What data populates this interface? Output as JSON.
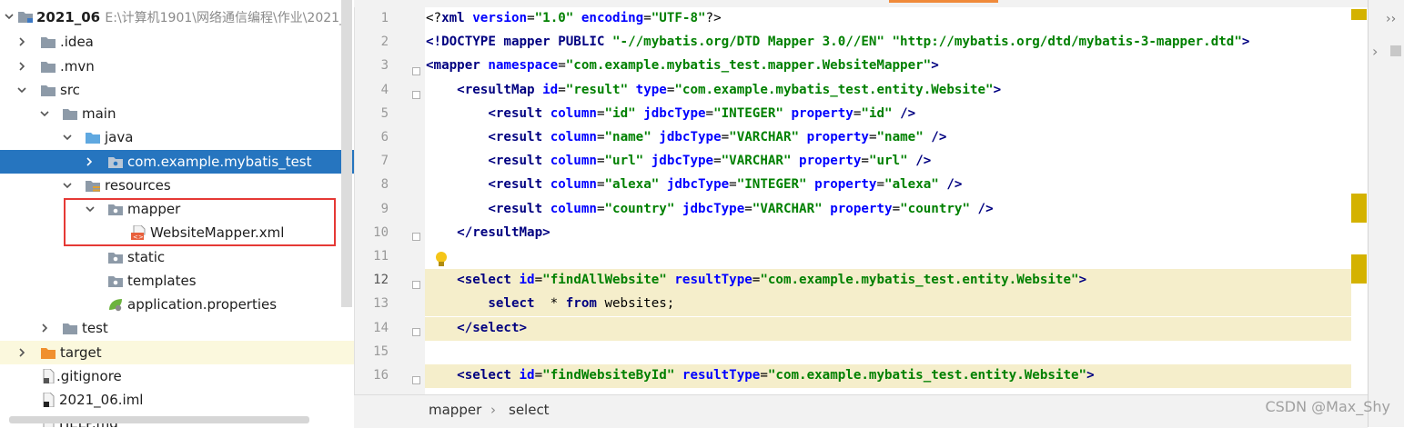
{
  "project_tree": {
    "root": {
      "name": "2021_06",
      "path": "E:\\计算机1901\\网络通信编程\\作业\\2021_"
    },
    "items": [
      {
        "label": ".idea"
      },
      {
        "label": ".mvn"
      },
      {
        "label": "src"
      },
      {
        "label": "main"
      },
      {
        "label": "java"
      },
      {
        "label": "com.example.mybatis_test"
      },
      {
        "label": "resources"
      },
      {
        "label": "mapper"
      },
      {
        "label": "WebsiteMapper.xml"
      },
      {
        "label": "static"
      },
      {
        "label": "templates"
      },
      {
        "label": "application.properties"
      },
      {
        "label": "test"
      },
      {
        "label": "target"
      },
      {
        "label": ".gitignore"
      },
      {
        "label": "2021_06.iml"
      },
      {
        "label": "HELP.md"
      }
    ]
  },
  "editor": {
    "line_numbers": [
      "1",
      "2",
      "3",
      "4",
      "5",
      "6",
      "7",
      "8",
      "9",
      "10",
      "11",
      "12",
      "13",
      "14",
      "15",
      "16"
    ],
    "current_line": "12",
    "lines": [
      [
        [
          "pi",
          "<?"
        ],
        [
          "tag",
          "xml "
        ],
        [
          "attr",
          "version"
        ],
        [
          "pi",
          "="
        ],
        [
          "val",
          "\"1.0\" "
        ],
        [
          "attr",
          "encoding"
        ],
        [
          "pi",
          "="
        ],
        [
          "val",
          "\"UTF-8\""
        ],
        [
          "pi",
          "?>"
        ]
      ],
      [
        [
          "tag",
          "<!DOCTYPE mapper PUBLIC "
        ],
        [
          "val",
          "\"-//mybatis.org/DTD Mapper 3.0//EN\" \"http://mybatis.org/dtd/mybatis-3-mapper.dtd\""
        ],
        [
          "tag",
          ">"
        ]
      ],
      [
        [
          "tag",
          "<mapper "
        ],
        [
          "attr",
          "namespace"
        ],
        [
          "pi",
          "="
        ],
        [
          "val",
          "\"com.example.mybatis_test.mapper.WebsiteMapper\""
        ],
        [
          "tag",
          ">"
        ]
      ],
      [
        [
          "pi",
          "    "
        ],
        [
          "tag",
          "<resultMap "
        ],
        [
          "attr",
          "id"
        ],
        [
          "pi",
          "="
        ],
        [
          "val",
          "\"result\" "
        ],
        [
          "attr",
          "type"
        ],
        [
          "pi",
          "="
        ],
        [
          "val",
          "\"com.example.mybatis_test.entity.Website\""
        ],
        [
          "tag",
          ">"
        ]
      ],
      [
        [
          "pi",
          "        "
        ],
        [
          "tag",
          "<result "
        ],
        [
          "attr",
          "column"
        ],
        [
          "pi",
          "="
        ],
        [
          "val",
          "\"id\" "
        ],
        [
          "attr",
          "jdbcType"
        ],
        [
          "pi",
          "="
        ],
        [
          "val",
          "\"INTEGER\" "
        ],
        [
          "attr",
          "property"
        ],
        [
          "pi",
          "="
        ],
        [
          "val",
          "\"id\" "
        ],
        [
          "tag",
          "/>"
        ]
      ],
      [
        [
          "pi",
          "        "
        ],
        [
          "tag",
          "<result "
        ],
        [
          "attr",
          "column"
        ],
        [
          "pi",
          "="
        ],
        [
          "val",
          "\"name\" "
        ],
        [
          "attr",
          "jdbcType"
        ],
        [
          "pi",
          "="
        ],
        [
          "val",
          "\"VARCHAR\" "
        ],
        [
          "attr",
          "property"
        ],
        [
          "pi",
          "="
        ],
        [
          "val",
          "\"name\" "
        ],
        [
          "tag",
          "/>"
        ]
      ],
      [
        [
          "pi",
          "        "
        ],
        [
          "tag",
          "<result "
        ],
        [
          "attr",
          "column"
        ],
        [
          "pi",
          "="
        ],
        [
          "val",
          "\"url\" "
        ],
        [
          "attr",
          "jdbcType"
        ],
        [
          "pi",
          "="
        ],
        [
          "val",
          "\"VARCHAR\" "
        ],
        [
          "attr",
          "property"
        ],
        [
          "pi",
          "="
        ],
        [
          "val",
          "\"url\" "
        ],
        [
          "tag",
          "/>"
        ]
      ],
      [
        [
          "pi",
          "        "
        ],
        [
          "tag",
          "<result "
        ],
        [
          "attr",
          "column"
        ],
        [
          "pi",
          "="
        ],
        [
          "val",
          "\"alexa\" "
        ],
        [
          "attr",
          "jdbcType"
        ],
        [
          "pi",
          "="
        ],
        [
          "val",
          "\"INTEGER\" "
        ],
        [
          "attr",
          "property"
        ],
        [
          "pi",
          "="
        ],
        [
          "val",
          "\"alexa\" "
        ],
        [
          "tag",
          "/>"
        ]
      ],
      [
        [
          "pi",
          "        "
        ],
        [
          "tag",
          "<result "
        ],
        [
          "attr",
          "column"
        ],
        [
          "pi",
          "="
        ],
        [
          "val",
          "\"country\" "
        ],
        [
          "attr",
          "jdbcType"
        ],
        [
          "pi",
          "="
        ],
        [
          "val",
          "\"VARCHAR\" "
        ],
        [
          "attr",
          "property"
        ],
        [
          "pi",
          "="
        ],
        [
          "val",
          "\"country\" "
        ],
        [
          "tag",
          "/>"
        ]
      ],
      [
        [
          "pi",
          "    "
        ],
        [
          "tag",
          "</resultMap>"
        ]
      ],
      [],
      [
        [
          "pi",
          "    "
        ],
        [
          "tag",
          "<select "
        ],
        [
          "attr",
          "id"
        ],
        [
          "pi",
          "="
        ],
        [
          "val",
          "\"findAllWebsite\" "
        ],
        [
          "attr",
          "resultType"
        ],
        [
          "pi",
          "="
        ],
        [
          "val",
          "\"com.example.mybatis_test.entity.Website\""
        ],
        [
          "tag",
          ">"
        ]
      ],
      [
        [
          "pi",
          "        "
        ],
        [
          "kw",
          "select"
        ],
        [
          "pi",
          "  * "
        ],
        [
          "kw",
          "from"
        ],
        [
          "pi",
          " websites;"
        ]
      ],
      [
        [
          "pi",
          "    "
        ],
        [
          "tag",
          "</select>"
        ]
      ],
      [],
      [
        [
          "pi",
          "    "
        ],
        [
          "tag",
          "<select "
        ],
        [
          "attr",
          "id"
        ],
        [
          "pi",
          "="
        ],
        [
          "val",
          "\"findWebsiteById\" "
        ],
        [
          "attr",
          "resultType"
        ],
        [
          "pi",
          "="
        ],
        [
          "val",
          "\"com.example.mybatis_test.entity.Website\""
        ],
        [
          "tag",
          ">"
        ]
      ]
    ]
  },
  "breadcrumb": {
    "items": [
      "mapper",
      "select"
    ],
    "separator": "›"
  },
  "watermark": "CSDN @Max_Shy",
  "colors": {
    "selection": "#2675bf",
    "highlight": "#f5eecb",
    "annotation_box": "#e53935",
    "marker": "#d4b200"
  }
}
